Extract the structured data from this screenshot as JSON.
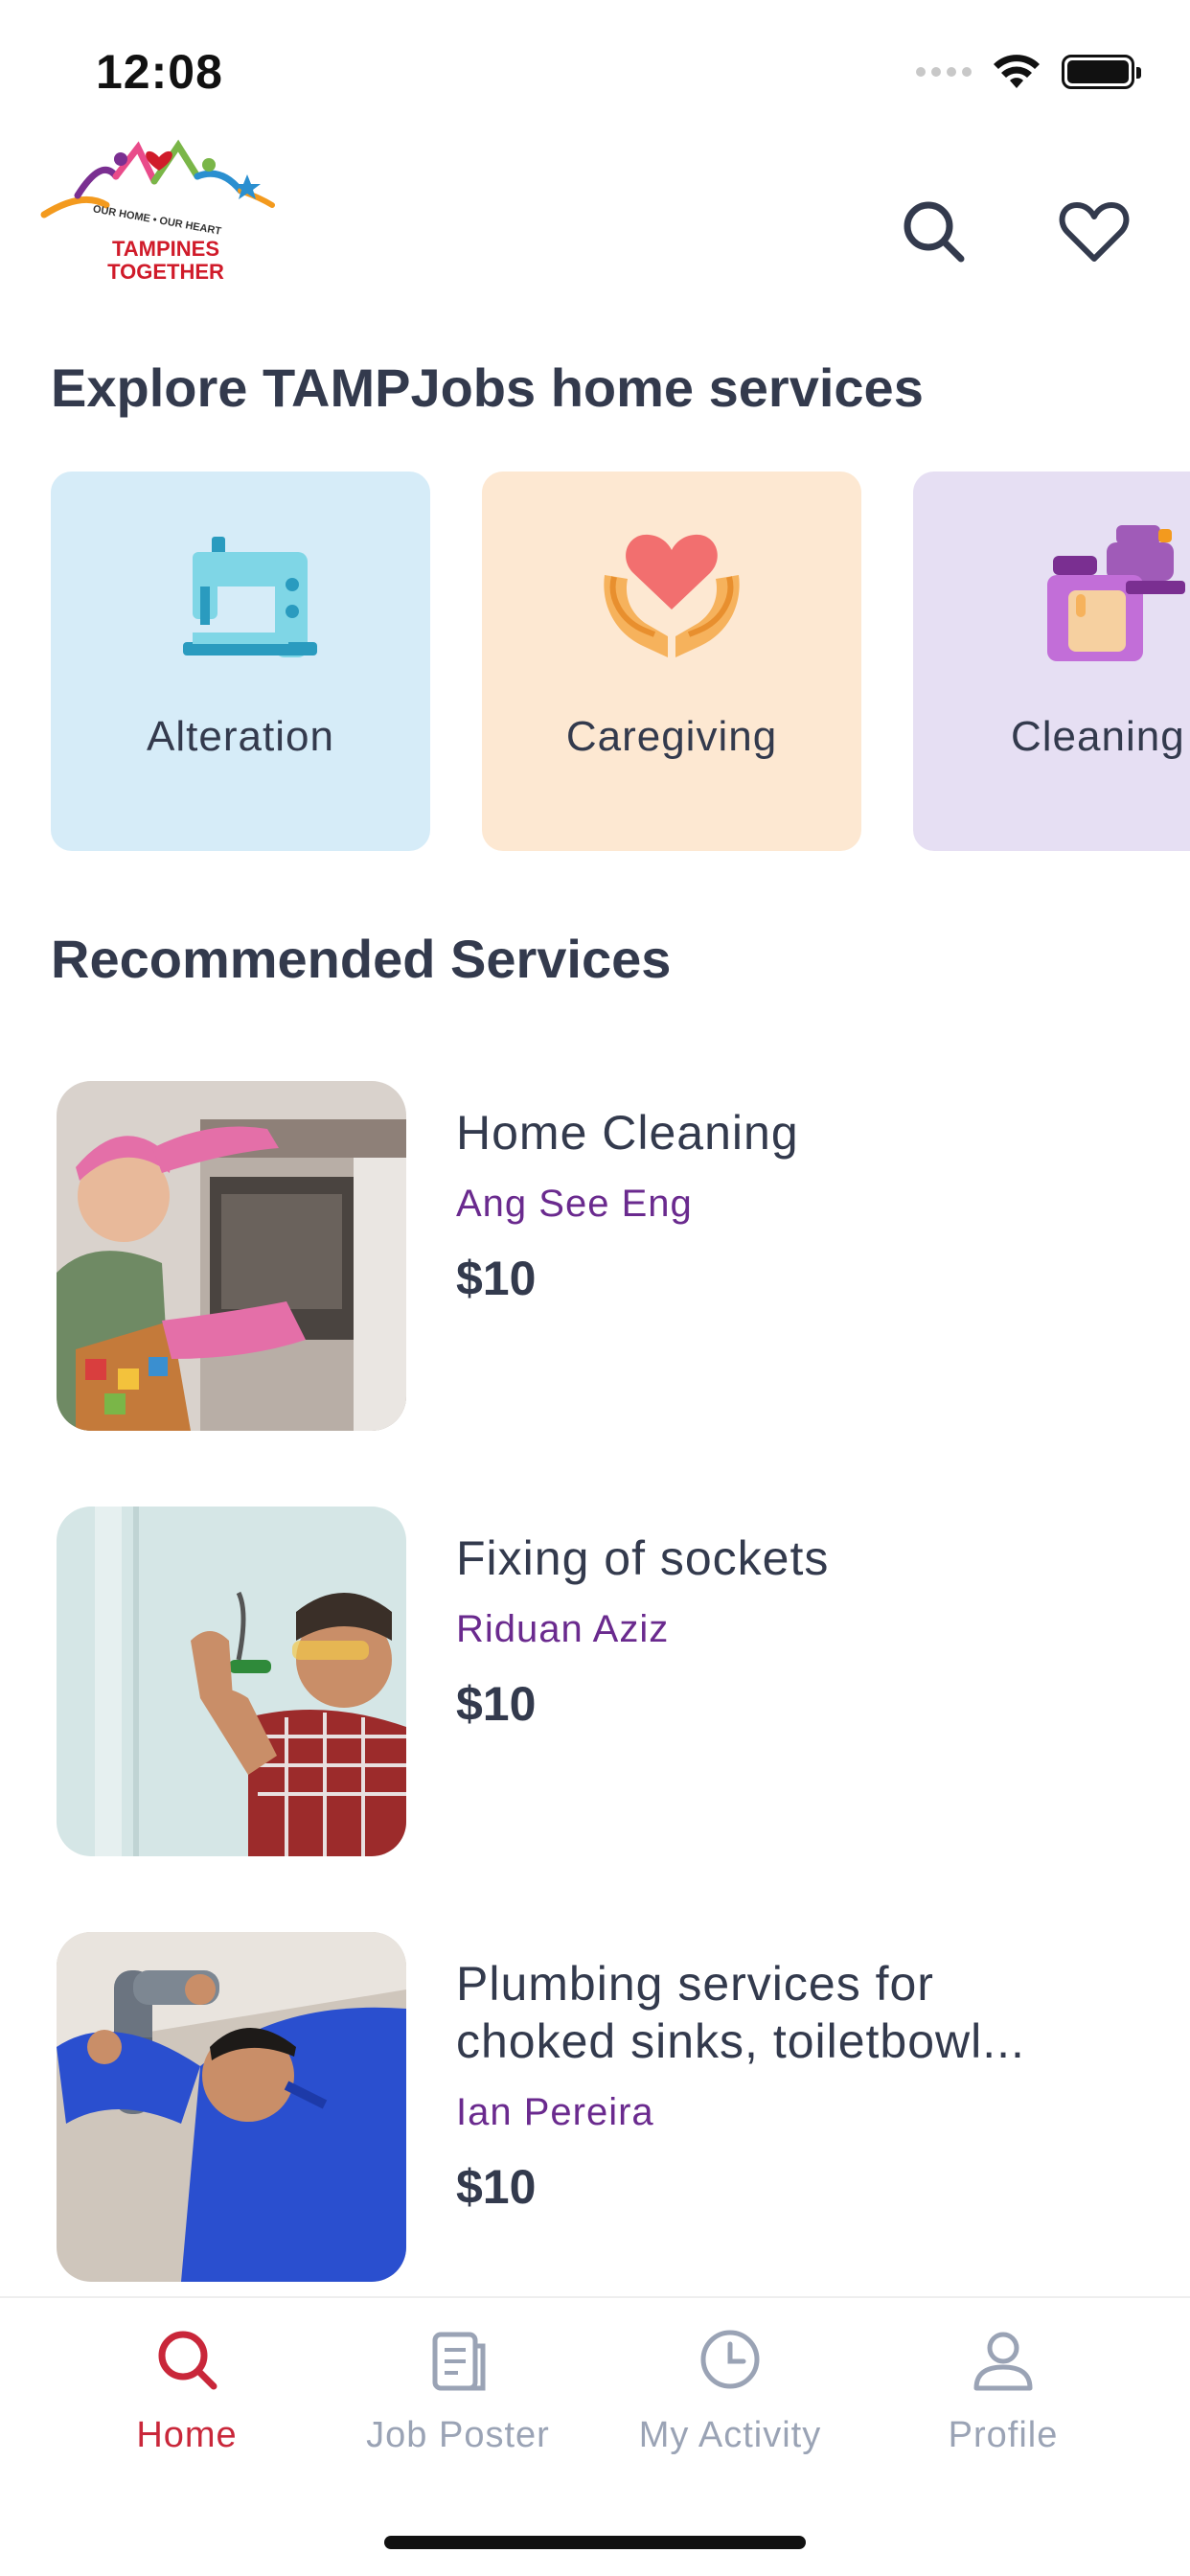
{
  "status_bar": {
    "time": "12:08",
    "icons": [
      "signal-icon",
      "wifi-icon",
      "battery-icon"
    ]
  },
  "header": {
    "logo": {
      "tagline": "OUR HOME • OUR HEART",
      "name_line1": "TAMPINES",
      "name_line2": "TOGETHER"
    },
    "actions": [
      "search-icon",
      "heart-icon"
    ]
  },
  "explore": {
    "title": "Explore TAMPJobs home services",
    "categories": [
      {
        "label": "Alteration",
        "icon": "sewing-machine-icon",
        "color": "#d6ecf8"
      },
      {
        "label": "Caregiving",
        "icon": "caring-hands-icon",
        "color": "#fde8d2"
      },
      {
        "label": "Cleaning",
        "icon": "cleaning-supplies-icon",
        "color": "#e6dff3"
      }
    ]
  },
  "recommended": {
    "title": "Recommended Services",
    "items": [
      {
        "title": "Home Cleaning",
        "provider": "Ang See Eng",
        "price": "$10"
      },
      {
        "title": "Fixing of sockets",
        "provider": "Riduan Aziz",
        "price": "$10"
      },
      {
        "title": "Plumbing services for choked sinks, toiletbowl...",
        "provider": "Ian Pereira",
        "price": "$10"
      }
    ]
  },
  "tab_bar": {
    "tabs": [
      {
        "label": "Home",
        "icon": "search-icon",
        "active": true
      },
      {
        "label": "Job Poster",
        "icon": "document-icon",
        "active": false
      },
      {
        "label": "My Activity",
        "icon": "clock-icon",
        "active": false
      },
      {
        "label": "Profile",
        "icon": "user-icon",
        "active": false
      }
    ]
  },
  "colors": {
    "accent": "#c9273a",
    "provider": "#6a2a8e",
    "text": "#333a4d",
    "inactive_tab": "#9aa3b5"
  }
}
